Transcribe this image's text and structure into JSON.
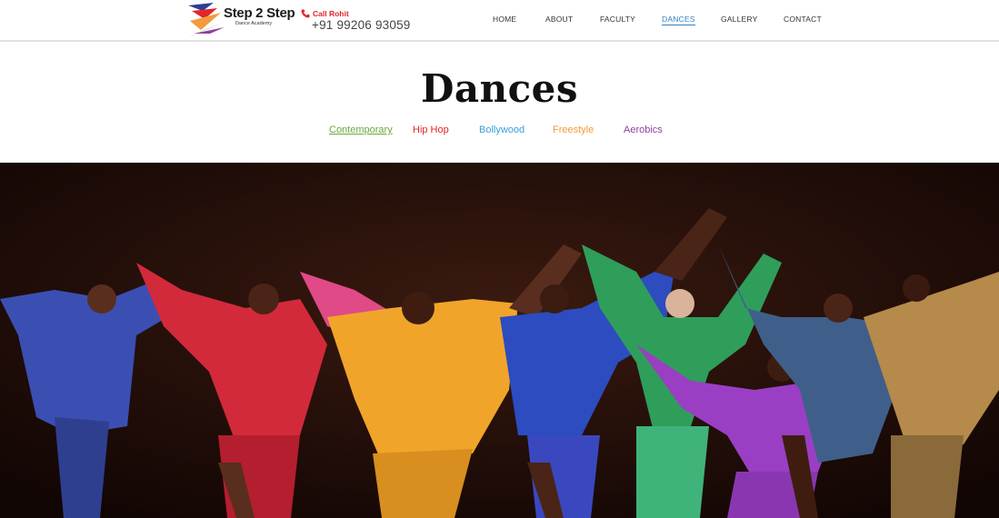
{
  "brand": {
    "name": "Step 2 Step",
    "tagline": "Dance Academy"
  },
  "contact": {
    "label": "Call Rohit",
    "phone": "+91 99206 93059",
    "icon": "phone-icon"
  },
  "nav": {
    "items": [
      {
        "label": "HOME"
      },
      {
        "label": "ABOUT"
      },
      {
        "label": "FACULTY"
      },
      {
        "label": "DANCES",
        "active": true
      },
      {
        "label": "GALLERY"
      },
      {
        "label": "CONTACT"
      }
    ]
  },
  "page": {
    "title": "Dances"
  },
  "dance_tabs": [
    {
      "label": "Contemporary",
      "color": "#6aa83a",
      "active": true
    },
    {
      "label": "Hip Hop",
      "color": "#e0262b"
    },
    {
      "label": "Bollywood",
      "color": "#3a9fd8"
    },
    {
      "label": "Freestyle",
      "color": "#f39a3d"
    },
    {
      "label": "Aerobics",
      "color": "#8e3fa0"
    }
  ],
  "colors": {
    "accent": "#2f7fc1",
    "call_red": "#e0262b",
    "hero_bg": "#1b0a06"
  }
}
